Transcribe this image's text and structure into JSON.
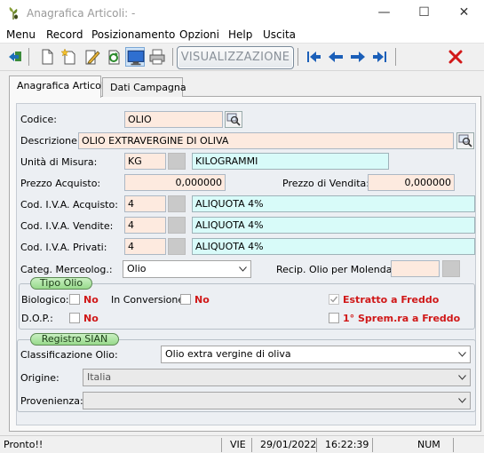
{
  "window": {
    "title": "Anagrafica Articoli: -",
    "min_glyph": "—",
    "max_glyph": "☐",
    "close_glyph": "✕"
  },
  "menu": [
    "Menu",
    "Record",
    "Posizionamento",
    "Opzioni",
    "Help",
    "Uscita"
  ],
  "toolbar": {
    "view_mode_label": "VISUALIZZAZIONE"
  },
  "tabs": [
    "Anagrafica Articoli",
    "Dati Campagna"
  ],
  "form": {
    "codice": {
      "label": "Codice:",
      "value": "OLIO"
    },
    "descrizione": {
      "label": "Descrizione:",
      "value": "OLIO EXTRAVERGINE DI OLIVA"
    },
    "unita": {
      "label": "Unità di Misura:",
      "code": "KG",
      "desc": "KILOGRAMMI"
    },
    "prezzo_acquisto": {
      "label": "Prezzo Acquisto:",
      "value": "0,000000"
    },
    "prezzo_vendita": {
      "label": "Prezzo di Vendita:",
      "value": "0,000000"
    },
    "iva_acquisto": {
      "label": "Cod. I.V.A. Acquisto:",
      "code": "4",
      "desc": "ALIQUOTA 4%"
    },
    "iva_vendite": {
      "label": "Cod. I.V.A. Vendite:",
      "code": "4",
      "desc": "ALIQUOTA 4%"
    },
    "iva_privati": {
      "label": "Cod. I.V.A. Privati:",
      "code": "4",
      "desc": "ALIQUOTA 4%"
    },
    "categoria": {
      "label": "Categ. Merceolog.:",
      "value": "Olio"
    },
    "recip": {
      "label": "Recip. Olio per Molenda:",
      "value": ""
    }
  },
  "tipo_olio": {
    "title": "Tipo Olio",
    "biologico": {
      "label": "Biologico:",
      "value": "No",
      "checked": false
    },
    "in_conversione": {
      "label": "In Conversione:",
      "value": "No",
      "checked": false
    },
    "dop": {
      "label": "D.O.P.:",
      "value": "No",
      "checked": false
    },
    "estratto_freddo": {
      "label": "Estratto a Freddo",
      "checked": true
    },
    "spremitura_freddo": {
      "label": "1° Sprem.ra a Freddo",
      "checked": false
    }
  },
  "registro_sian": {
    "title": "Registro SIAN",
    "classificazione": {
      "label": "Classificazione Olio:",
      "value": "Olio extra vergine di oliva"
    },
    "origine": {
      "label": "Origine:",
      "value": "Italia"
    },
    "provenienza": {
      "label": "Provenienza:",
      "value": ""
    }
  },
  "status": {
    "message": "Pronto!!",
    "day": "VIE",
    "date": "29/01/2022",
    "time": "16:22:39",
    "num": "NUM"
  }
}
